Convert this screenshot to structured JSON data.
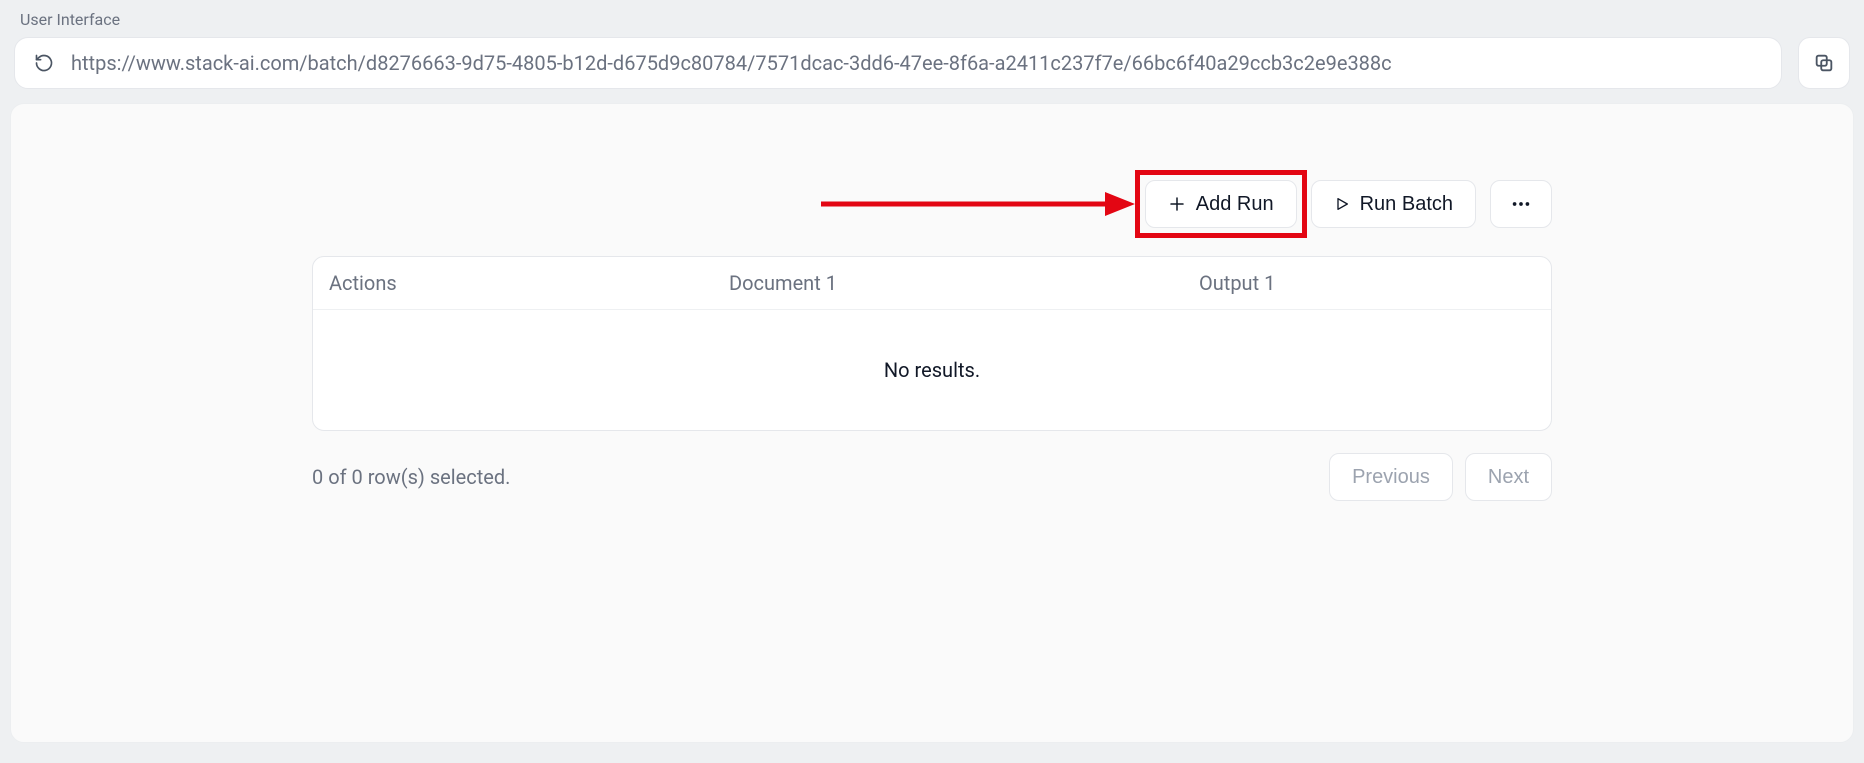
{
  "header": {
    "page_label": "User Interface",
    "url": "https://www.stack-ai.com/batch/d8276663-9d75-4805-b12d-d675d9c80784/7571dcac-3dd6-47ee-8f6a-a2411c237f7e/66bc6f40a29ccb3c2e9e388c"
  },
  "toolbar": {
    "add_run_label": "Add Run",
    "run_batch_label": "Run Batch"
  },
  "table": {
    "columns": [
      "Actions",
      "Document 1",
      "Output 1"
    ],
    "empty_label": "No results."
  },
  "footer": {
    "selection_text": "0 of 0 row(s) selected.",
    "prev_label": "Previous",
    "next_label": "Next"
  }
}
